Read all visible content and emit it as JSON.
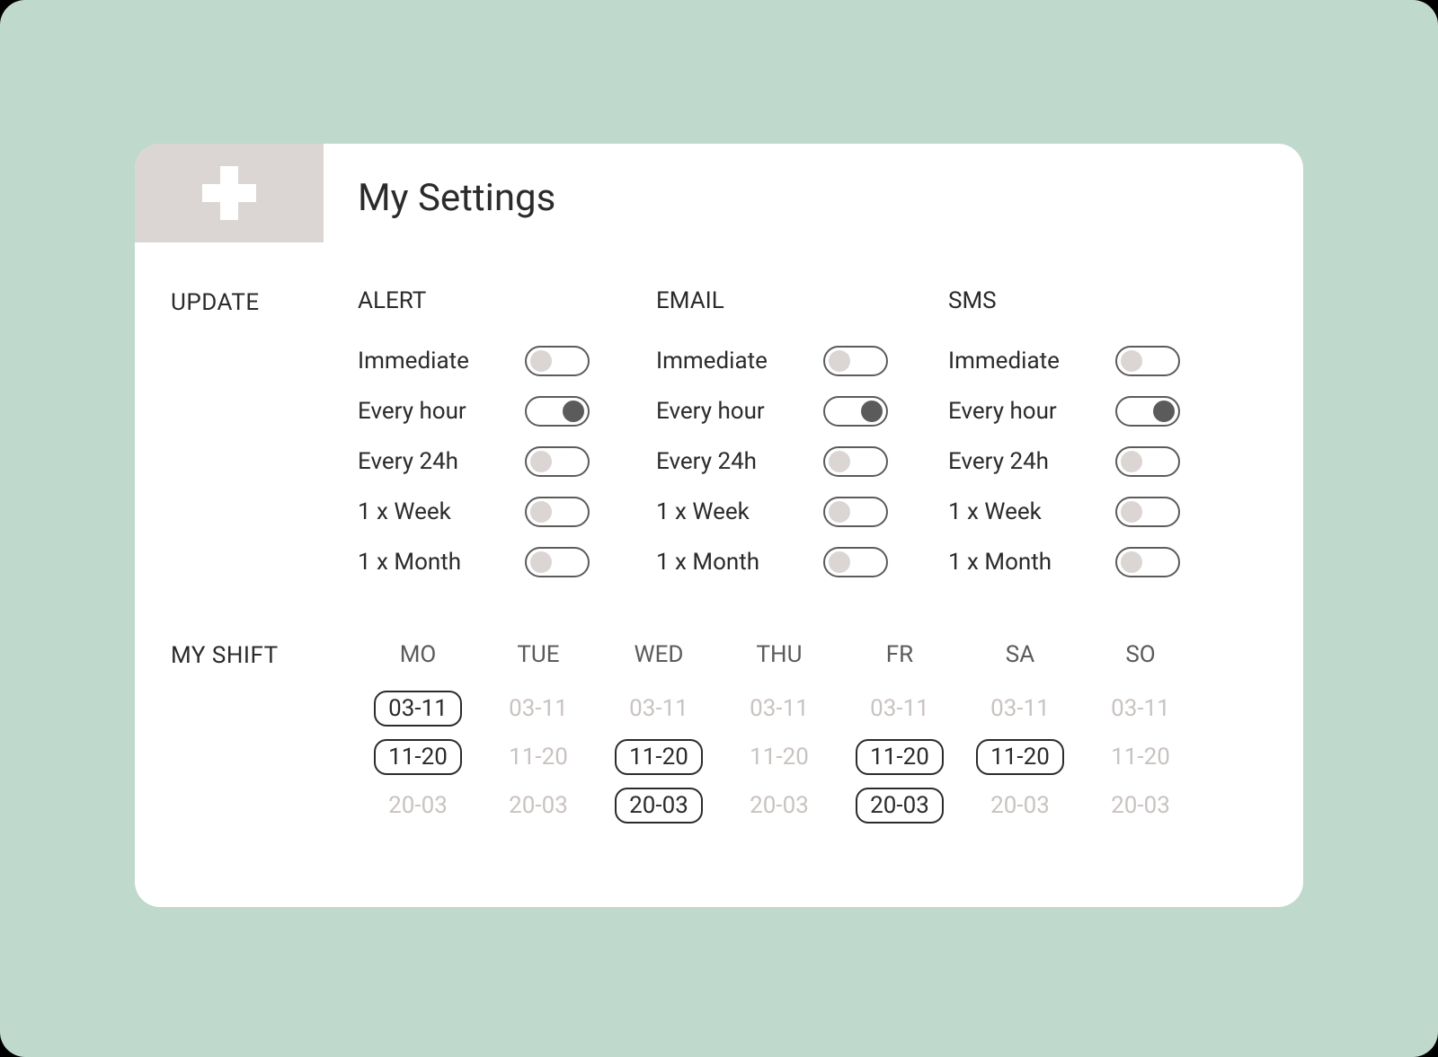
{
  "title": "My Settings",
  "sections": {
    "update_label": "UPDATE",
    "shift_label": "MY SHIFT"
  },
  "update": {
    "columns": [
      {
        "key": "alert",
        "header": "ALERT"
      },
      {
        "key": "email",
        "header": "EMAIL"
      },
      {
        "key": "sms",
        "header": "SMS"
      }
    ],
    "options": [
      {
        "key": "immediate",
        "label": "Immediate",
        "values": {
          "alert": false,
          "email": false,
          "sms": false
        }
      },
      {
        "key": "every_hour",
        "label": "Every hour",
        "values": {
          "alert": true,
          "email": true,
          "sms": true
        }
      },
      {
        "key": "every_24h",
        "label": "Every 24h",
        "values": {
          "alert": false,
          "email": false,
          "sms": false
        }
      },
      {
        "key": "weekly",
        "label": "1 x Week",
        "values": {
          "alert": false,
          "email": false,
          "sms": false
        }
      },
      {
        "key": "monthly",
        "label": "1 x Month",
        "values": {
          "alert": false,
          "email": false,
          "sms": false
        }
      }
    ]
  },
  "shift": {
    "days": [
      "MO",
      "TUE",
      "WED",
      "THU",
      "FR",
      "SA",
      "SO"
    ],
    "slots": [
      "03-11",
      "11-20",
      "20-03"
    ],
    "selected": {
      "MO": [
        "03-11",
        "11-20"
      ],
      "TUE": [],
      "WED": [
        "11-20",
        "20-03"
      ],
      "THU": [],
      "FR": [
        "11-20",
        "20-03"
      ],
      "SA": [
        "11-20"
      ],
      "SO": []
    }
  }
}
